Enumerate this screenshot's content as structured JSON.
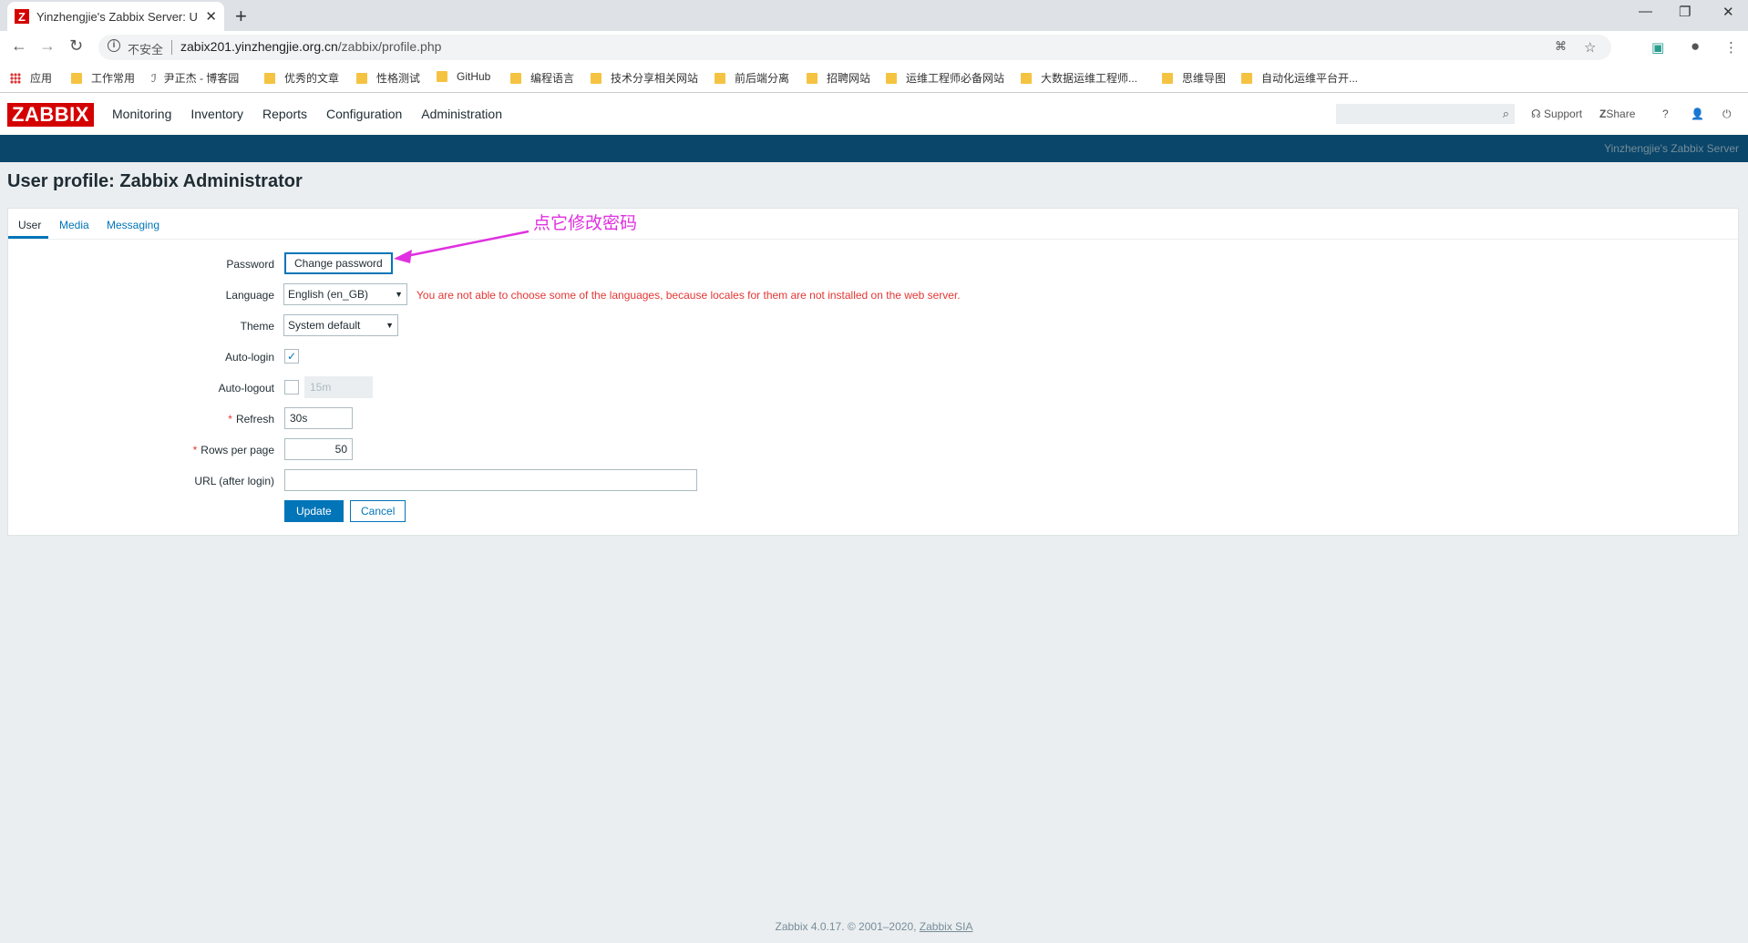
{
  "browser": {
    "tab_title": "Yinzhengjie's Zabbix Server: U",
    "favicon_letter": "Z",
    "address": {
      "security_label": "不安全",
      "host": "zabix201.yinzhengjie.org.cn",
      "path": "/zabbix/profile.php"
    },
    "bookmarks": [
      "应用",
      "工作常用",
      "尹正杰 - 博客园",
      "优秀的文章",
      "性格测试",
      "GitHub",
      "编程语言",
      "技术分享相关网站",
      "前后端分离",
      "招聘网站",
      "运维工程师必备网站",
      "大数据运维工程师...",
      "思维导图",
      "自动化运维平台开..."
    ]
  },
  "header": {
    "logo": "ZABBIX",
    "nav": [
      "Monitoring",
      "Inventory",
      "Reports",
      "Configuration",
      "Administration"
    ],
    "support_label": "Support",
    "share_label": "Share",
    "help_label": "?",
    "server_name": "Yinzhengjie's Zabbix Server"
  },
  "page": {
    "title": "User profile: Zabbix Administrator",
    "tabs": [
      "User",
      "Media",
      "Messaging"
    ],
    "active_tab": "User"
  },
  "form": {
    "password": {
      "label": "Password",
      "button": "Change password"
    },
    "language": {
      "label": "Language",
      "value": "English (en_GB)",
      "warning": "You are not able to choose some of the languages, because locales for them are not installed on the web server."
    },
    "theme": {
      "label": "Theme",
      "value": "System default"
    },
    "autologin": {
      "label": "Auto-login",
      "checked": true
    },
    "autologout": {
      "label": "Auto-logout",
      "checked": false,
      "value": "15m"
    },
    "refresh": {
      "label": "Refresh",
      "value": "30s"
    },
    "rows_per_page": {
      "label": "Rows per page",
      "value": "50"
    },
    "url": {
      "label": "URL (after login)",
      "value": ""
    },
    "update_button": "Update",
    "cancel_button": "Cancel"
  },
  "annotation": {
    "text": "点它修改密码",
    "color": "#e030e0"
  },
  "footer": {
    "text": "Zabbix 4.0.17. © 2001–2020, ",
    "link": "Zabbix SIA"
  },
  "colors": {
    "brand_red": "#d40000",
    "nav_blue": "#0a466a",
    "accent": "#0275b8",
    "error": "#e33734"
  }
}
